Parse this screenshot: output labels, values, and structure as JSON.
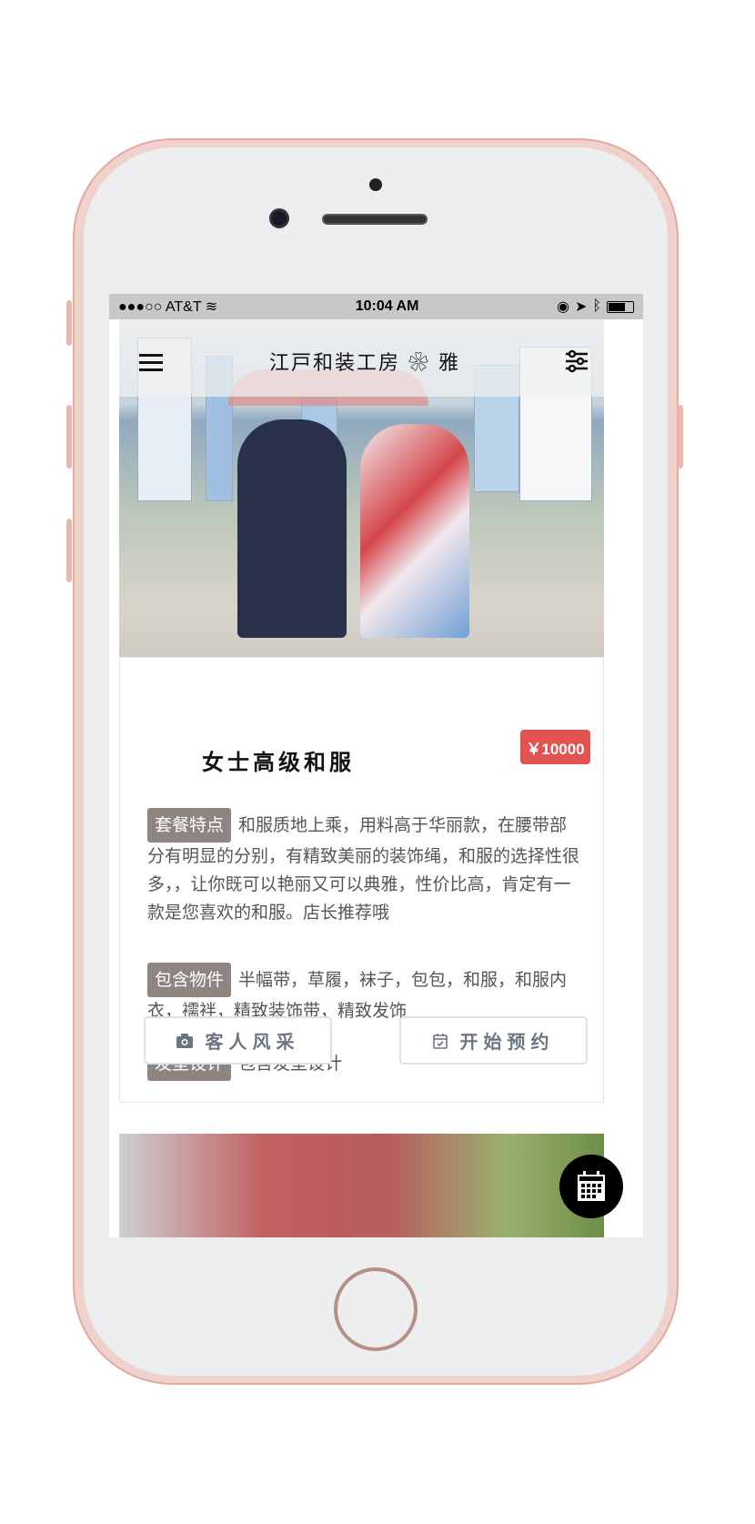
{
  "status_bar": {
    "carrier": "●●●○○ AT&T",
    "time": "10:04 AM"
  },
  "header": {
    "logo": "江戸和装工房 ❀ 雅"
  },
  "product": {
    "title": "女士高级和服",
    "price": "￥10000",
    "features_label": "套餐特点",
    "features_text": "和服质地上乘，用料高于华丽款，在腰带部分有明显的分别，有精致美丽的装饰绳，和服的选择性很多，，让你既可以艳丽又可以典雅，性价比高，肯定有一款是您喜欢的和服。店长推荐哦",
    "items_label": "包含物件",
    "items_text": "半幅带，草履，袜子，包包，和服，和服内衣，襦袢，精致装饰带，精致发饰",
    "hair_label": "发型设计",
    "hair_text": "包含发型设计"
  },
  "buttons": {
    "gallery": "客人风采",
    "reserve": "开始预约"
  },
  "colors": {
    "price": "#e05350",
    "tag": "#8f8580",
    "phone": "#f0d2cc"
  }
}
